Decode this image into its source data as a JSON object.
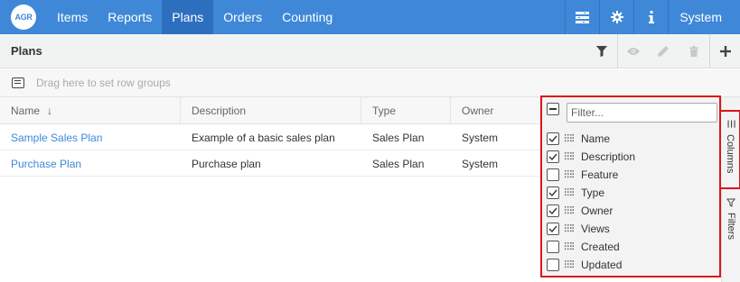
{
  "app": {
    "logo_text": "AGR",
    "nav": [
      {
        "label": "Items"
      },
      {
        "label": "Reports"
      },
      {
        "label": "Plans"
      },
      {
        "label": "Orders"
      },
      {
        "label": "Counting"
      }
    ],
    "active_nav": "Plans",
    "system_label": "System",
    "brand_color": "#3f88d8",
    "active_tab_color": "#2d6fbf"
  },
  "page": {
    "title": "Plans",
    "toolbar_icons": [
      "filter-icon",
      "view-icon",
      "edit-icon",
      "delete-icon",
      "add-icon"
    ]
  },
  "groupbar": {
    "placeholder": "Drag here to set row groups"
  },
  "grid": {
    "headers": [
      {
        "label": "Name",
        "sort": "↓"
      },
      {
        "label": "Description"
      },
      {
        "label": "Type"
      },
      {
        "label": "Owner"
      }
    ],
    "rows": [
      {
        "name": "Sample Sales Plan",
        "description": "Example of a basic sales plan",
        "type": "Sales Plan",
        "owner": "System"
      },
      {
        "name": "Purchase Plan",
        "description": "Purchase plan",
        "type": "Sales Plan",
        "owner": "System"
      }
    ]
  },
  "columns_panel": {
    "filter_placeholder": "Filter...",
    "items": [
      {
        "label": "Name",
        "checked": true
      },
      {
        "label": "Description",
        "checked": true
      },
      {
        "label": "Feature",
        "checked": false
      },
      {
        "label": "Type",
        "checked": true
      },
      {
        "label": "Owner",
        "checked": true
      },
      {
        "label": "Views",
        "checked": true
      },
      {
        "label": "Created",
        "checked": false
      },
      {
        "label": "Updated",
        "checked": false
      }
    ],
    "highlight_color": "#d9161c"
  },
  "sidebar": {
    "columns_label": "Columns",
    "filters_label": "Filters"
  }
}
